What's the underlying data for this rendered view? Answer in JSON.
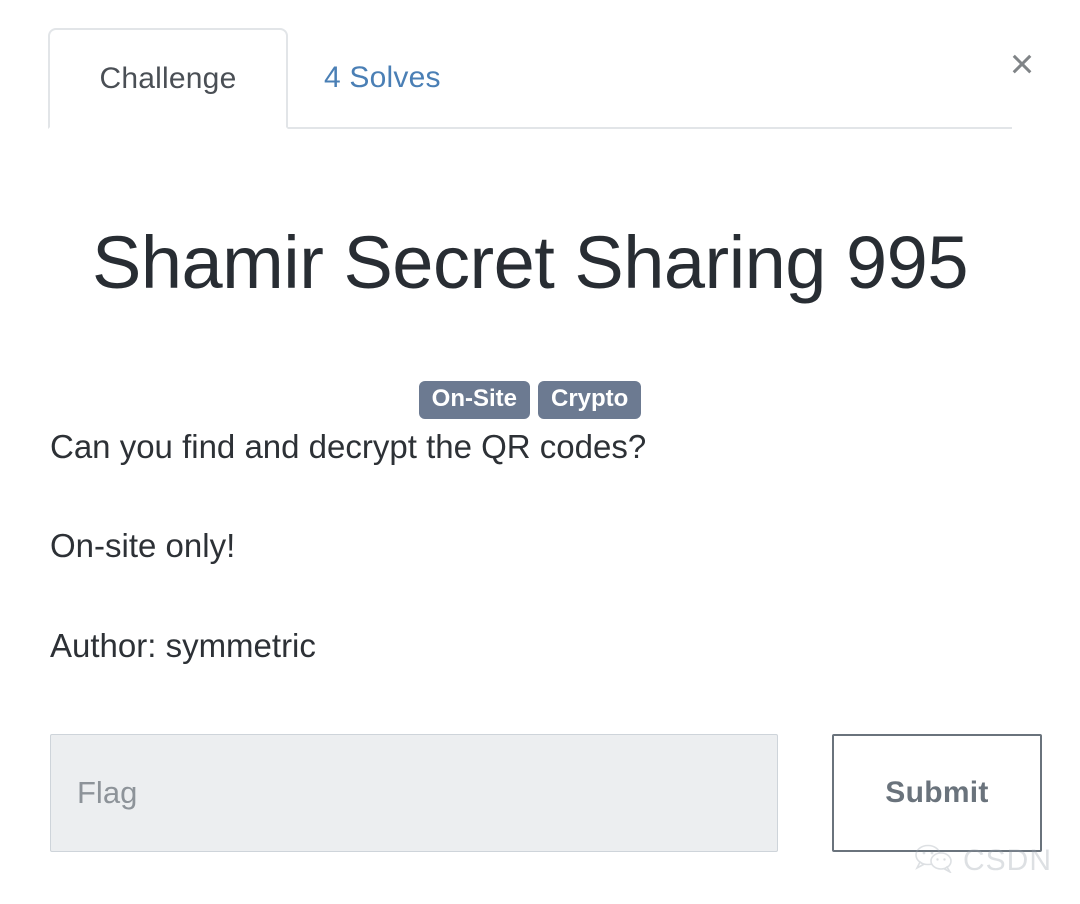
{
  "modal": {
    "close_label": "×"
  },
  "tabs": [
    {
      "label": "Challenge",
      "active": true
    },
    {
      "label": "4 Solves",
      "active": false
    }
  ],
  "challenge": {
    "title": "Shamir Secret Sharing 995",
    "tags": [
      "On-Site",
      "Crypto"
    ],
    "description": [
      "Can you find and decrypt the QR codes?",
      "On-site only!",
      "Author: symmetric"
    ]
  },
  "form": {
    "flag_value": "",
    "flag_placeholder": "Flag",
    "submit_label": "Submit"
  },
  "watermark": {
    "text": "CSDN"
  },
  "colors": {
    "link_blue": "#4a7fb5",
    "tag_bg": "#6c7a91",
    "title": "#282d33",
    "tab_border": "#e2e5e8",
    "submit_border": "#6a737c",
    "input_bg": "#eceef0"
  }
}
